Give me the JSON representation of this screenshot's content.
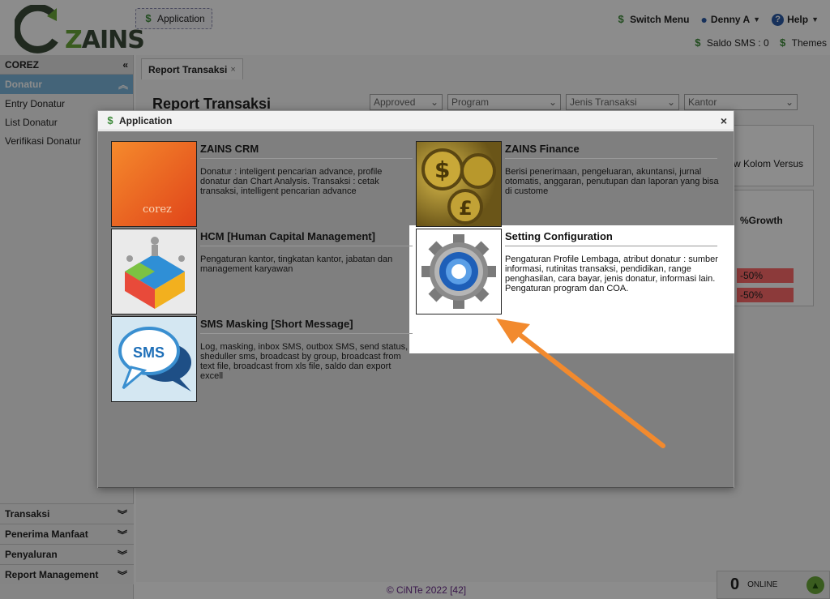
{
  "header": {
    "logo_text_left": "Z",
    "logo_text_right": "AINS",
    "app_button_label": "Application",
    "switch_menu": "Switch Menu",
    "user_name": "Denny A",
    "help": "Help",
    "saldo_sms": "Saldo SMS : 0",
    "themes": "Themes"
  },
  "sidebar": {
    "title": "COREZ",
    "active_section": "Donatur",
    "items": [
      "Entry Donatur",
      "List Donatur",
      "Verifikasi Donatur"
    ],
    "bottom_sections": [
      "Transaksi",
      "Penerima Manfaat",
      "Penyaluran",
      "Report Management"
    ]
  },
  "main": {
    "tab_label": "Report Transaksi",
    "page_title": "Report Transaksi",
    "filters": [
      "Approved",
      "Program",
      "Jenis Transaksi",
      "Kantor"
    ],
    "card_text": "w Kolom Versus",
    "growth_header": "%Growth",
    "growth_values": [
      "-50%",
      "-50%"
    ]
  },
  "footer": {
    "copyright": "© CiNTe 2022 [42]",
    "online_count": "0",
    "online_label": "ONLINE"
  },
  "dialog": {
    "title": "Application",
    "apps": [
      {
        "name": "ZAINS CRM",
        "desc": "Donatur : inteligent pencarian advance, profile donatur dan Chart Analysis. Transaksi : cetak transaksi, intelligent pencarian advance"
      },
      {
        "name": "ZAINS Finance",
        "desc": "Berisi penerimaan, pengeluaran, akuntansi, jurnal otomatis, anggaran, penutupan dan laporan yang bisa di custome"
      },
      {
        "name": "HCM [Human Capital Management]",
        "desc": "Pengaturan kantor, tingkatan kantor, jabatan dan management karyawan"
      },
      {
        "name": "Setting Configuration",
        "desc": "Pengaturan Profile Lembaga, atribut donatur : sumber informasi, rutinitas transaksi, pendidikan, range penghasilan, cara bayar, jenis donatur, informasi lain. Pengaturan program dan COA."
      },
      {
        "name": "SMS Masking [Short Message]",
        "desc": "Log, masking, inbox SMS, outbox SMS, send status, sheduller sms, broadcast by group, broadcast from text file, broadcast from xls file, saldo dan export excell"
      }
    ],
    "sms_thumb_text": "SMS",
    "crm_thumb_text": "corez"
  },
  "colors": {
    "accent": "#7db7dc",
    "arrow": "#f28a2e",
    "logo_green": "#6aa83a"
  }
}
